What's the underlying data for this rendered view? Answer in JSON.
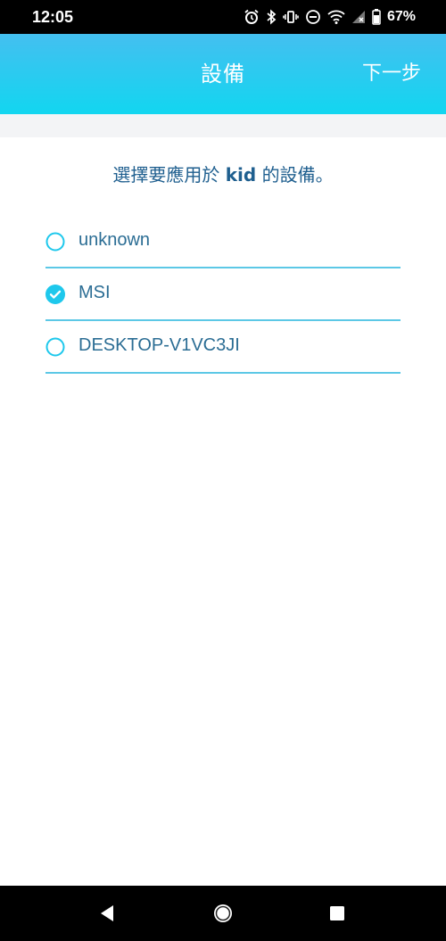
{
  "status_bar": {
    "time": "12:05",
    "battery_percent": "67%",
    "icons": [
      "alarm-icon",
      "bluetooth-icon",
      "vibrate-icon",
      "do-not-disturb-icon",
      "wifi-icon",
      "signal-icon",
      "battery-icon"
    ]
  },
  "app_bar": {
    "title": "設備",
    "next_label": "下一步"
  },
  "instruction": {
    "prefix": "選擇要應用於 ",
    "user": "kid",
    "suffix": " 的設備。"
  },
  "devices": [
    {
      "name": "unknown",
      "selected": false
    },
    {
      "name": "MSI",
      "selected": true
    },
    {
      "name": "DESKTOP-V1VC3JI",
      "selected": false
    }
  ],
  "nav_bar": {
    "buttons": [
      "back-icon",
      "home-icon",
      "recents-icon"
    ]
  },
  "colors": {
    "accent": "#1ec8ec",
    "header_top": "#44bff0",
    "header_bottom": "#12d6f0",
    "text": "#2b6d94"
  }
}
